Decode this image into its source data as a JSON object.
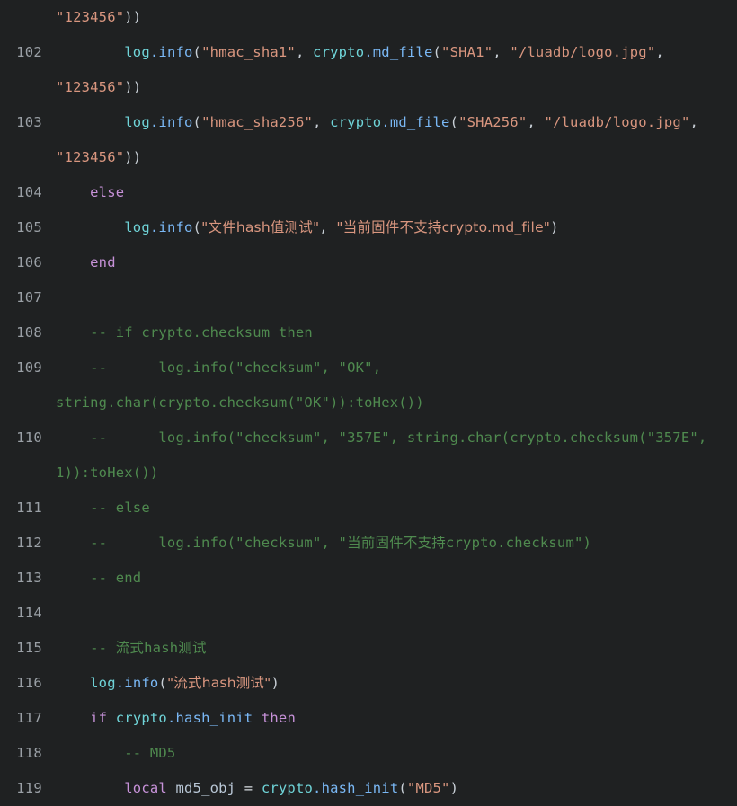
{
  "editor": {
    "language": "lua",
    "theme": "dark",
    "background_color": "#1f2122",
    "gutter_color": "#9aa0a6",
    "colors": {
      "object": "#6fd4d8",
      "property": "#7ab8f5",
      "string": "#d9967f",
      "keyword": "#c792d9",
      "comment": "#4f8a4f",
      "plain": "#d6dbe0"
    }
  },
  "lines": [
    {
      "number": "",
      "rows": [
        {
          "indent": 55,
          "tokens": [
            {
              "t": "\"123456\"",
              "c": "t-str"
            },
            {
              "t": "))",
              "c": "t-punct"
            }
          ]
        }
      ]
    },
    {
      "number": "102",
      "rows": [
        {
          "indent": 0,
          "tokens": [
            {
              "t": "        ",
              "c": "t-plain"
            },
            {
              "t": "log",
              "c": "t-obj"
            },
            {
              "t": ".info",
              "c": "t-prop"
            },
            {
              "t": "(",
              "c": "t-punct"
            },
            {
              "t": "\"hmac_sha1\"",
              "c": "t-str"
            },
            {
              "t": ", ",
              "c": "t-punct"
            },
            {
              "t": "crypto",
              "c": "t-obj"
            },
            {
              "t": ".md_file",
              "c": "t-prop"
            },
            {
              "t": "(",
              "c": "t-punct"
            },
            {
              "t": "\"SHA1\"",
              "c": "t-str"
            },
            {
              "t": ", ",
              "c": "t-punct"
            },
            {
              "t": "\"/luadb/logo.jpg\"",
              "c": "t-str"
            },
            {
              "t": ",",
              "c": "t-punct"
            }
          ]
        },
        {
          "indent": 55,
          "tokens": [
            {
              "t": "\"123456\"",
              "c": "t-str"
            },
            {
              "t": "))",
              "c": "t-punct"
            }
          ]
        }
      ]
    },
    {
      "number": "103",
      "rows": [
        {
          "indent": 0,
          "tokens": [
            {
              "t": "        ",
              "c": "t-plain"
            },
            {
              "t": "log",
              "c": "t-obj"
            },
            {
              "t": ".info",
              "c": "t-prop"
            },
            {
              "t": "(",
              "c": "t-punct"
            },
            {
              "t": "\"hmac_sha256\"",
              "c": "t-str"
            },
            {
              "t": ", ",
              "c": "t-punct"
            },
            {
              "t": "crypto",
              "c": "t-obj"
            },
            {
              "t": ".md_file",
              "c": "t-prop"
            },
            {
              "t": "(",
              "c": "t-punct"
            },
            {
              "t": "\"SHA256\"",
              "c": "t-str"
            },
            {
              "t": ", ",
              "c": "t-punct"
            },
            {
              "t": "\"/luadb/logo.jpg\"",
              "c": "t-str"
            },
            {
              "t": ",",
              "c": "t-punct"
            }
          ]
        },
        {
          "indent": 55,
          "tokens": [
            {
              "t": "\"123456\"",
              "c": "t-str"
            },
            {
              "t": "))",
              "c": "t-punct"
            }
          ]
        }
      ]
    },
    {
      "number": "104",
      "rows": [
        {
          "indent": 0,
          "tokens": [
            {
              "t": "    ",
              "c": "t-plain"
            },
            {
              "t": "else",
              "c": "t-kw"
            }
          ]
        }
      ]
    },
    {
      "number": "105",
      "rows": [
        {
          "indent": 0,
          "tokens": [
            {
              "t": "        ",
              "c": "t-plain"
            },
            {
              "t": "log",
              "c": "t-obj"
            },
            {
              "t": ".info",
              "c": "t-prop"
            },
            {
              "t": "(",
              "c": "t-punct"
            },
            {
              "t": "\"文件hash值测试\"",
              "c": "t-str cjk"
            },
            {
              "t": ", ",
              "c": "t-punct"
            },
            {
              "t": "\"当前固件不支持crypto.md_file\"",
              "c": "t-str cjk"
            },
            {
              "t": ")",
              "c": "t-punct"
            }
          ]
        }
      ]
    },
    {
      "number": "106",
      "rows": [
        {
          "indent": 0,
          "tokens": [
            {
              "t": "    ",
              "c": "t-plain"
            },
            {
              "t": "end",
              "c": "t-kw"
            }
          ]
        }
      ]
    },
    {
      "number": "107",
      "rows": [
        {
          "indent": 0,
          "tokens": []
        }
      ]
    },
    {
      "number": "108",
      "rows": [
        {
          "indent": 0,
          "tokens": [
            {
              "t": "    ",
              "c": "t-plain"
            },
            {
              "t": "-- if crypto.checksum then",
              "c": "t-comment"
            }
          ]
        }
      ]
    },
    {
      "number": "109",
      "rows": [
        {
          "indent": 0,
          "tokens": [
            {
              "t": "    ",
              "c": "t-plain"
            },
            {
              "t": "--      log.info(\"checksum\", \"OK\",",
              "c": "t-comment"
            }
          ]
        },
        {
          "indent": 55,
          "tokens": [
            {
              "t": "string.char(crypto.checksum(\"OK\")):toHex())",
              "c": "t-comment"
            }
          ]
        }
      ]
    },
    {
      "number": "110",
      "rows": [
        {
          "indent": 0,
          "tokens": [
            {
              "t": "    ",
              "c": "t-plain"
            },
            {
              "t": "--      log.info(\"checksum\", \"357E\", string.char(crypto.checksum(\"357E\",",
              "c": "t-comment"
            }
          ]
        },
        {
          "indent": 55,
          "tokens": [
            {
              "t": "1)):toHex())",
              "c": "t-comment"
            }
          ]
        }
      ]
    },
    {
      "number": "111",
      "rows": [
        {
          "indent": 0,
          "tokens": [
            {
              "t": "    ",
              "c": "t-plain"
            },
            {
              "t": "-- else",
              "c": "t-comment"
            }
          ]
        }
      ]
    },
    {
      "number": "112",
      "rows": [
        {
          "indent": 0,
          "tokens": [
            {
              "t": "    ",
              "c": "t-plain"
            },
            {
              "t": "--      log.info(\"checksum\", \"当前固件不支持crypto.checksum\")",
              "c": "t-comment cjk-mixed"
            }
          ]
        }
      ]
    },
    {
      "number": "113",
      "rows": [
        {
          "indent": 0,
          "tokens": [
            {
              "t": "    ",
              "c": "t-plain"
            },
            {
              "t": "-- end",
              "c": "t-comment"
            }
          ]
        }
      ]
    },
    {
      "number": "114",
      "rows": [
        {
          "indent": 0,
          "tokens": []
        }
      ]
    },
    {
      "number": "115",
      "rows": [
        {
          "indent": 0,
          "tokens": [
            {
              "t": "    ",
              "c": "t-plain"
            },
            {
              "t": "-- 流式hash测试",
              "c": "t-comment cjk-mixed"
            }
          ]
        }
      ]
    },
    {
      "number": "116",
      "rows": [
        {
          "indent": 0,
          "tokens": [
            {
              "t": "    ",
              "c": "t-plain"
            },
            {
              "t": "log",
              "c": "t-obj"
            },
            {
              "t": ".info",
              "c": "t-prop"
            },
            {
              "t": "(",
              "c": "t-punct"
            },
            {
              "t": "\"流式hash测试\"",
              "c": "t-str cjk"
            },
            {
              "t": ")",
              "c": "t-punct"
            }
          ]
        }
      ]
    },
    {
      "number": "117",
      "rows": [
        {
          "indent": 0,
          "tokens": [
            {
              "t": "    ",
              "c": "t-plain"
            },
            {
              "t": "if",
              "c": "t-kw"
            },
            {
              "t": " ",
              "c": "t-plain"
            },
            {
              "t": "crypto",
              "c": "t-obj"
            },
            {
              "t": ".hash_init",
              "c": "t-prop"
            },
            {
              "t": " ",
              "c": "t-plain"
            },
            {
              "t": "then",
              "c": "t-kw"
            }
          ]
        }
      ]
    },
    {
      "number": "118",
      "rows": [
        {
          "indent": 0,
          "tokens": [
            {
              "t": "        ",
              "c": "t-plain"
            },
            {
              "t": "-- MD5",
              "c": "t-comment"
            }
          ]
        }
      ]
    },
    {
      "number": "119",
      "rows": [
        {
          "indent": 0,
          "tokens": [
            {
              "t": "        ",
              "c": "t-plain"
            },
            {
              "t": "local",
              "c": "t-kw"
            },
            {
              "t": " ",
              "c": "t-plain"
            },
            {
              "t": "md5_obj",
              "c": "t-var"
            },
            {
              "t": " = ",
              "c": "t-plain"
            },
            {
              "t": "crypto",
              "c": "t-obj"
            },
            {
              "t": ".hash_init",
              "c": "t-prop"
            },
            {
              "t": "(",
              "c": "t-punct"
            },
            {
              "t": "\"MD5\"",
              "c": "t-str"
            },
            {
              "t": ")",
              "c": "t-punct"
            }
          ]
        }
      ]
    }
  ]
}
